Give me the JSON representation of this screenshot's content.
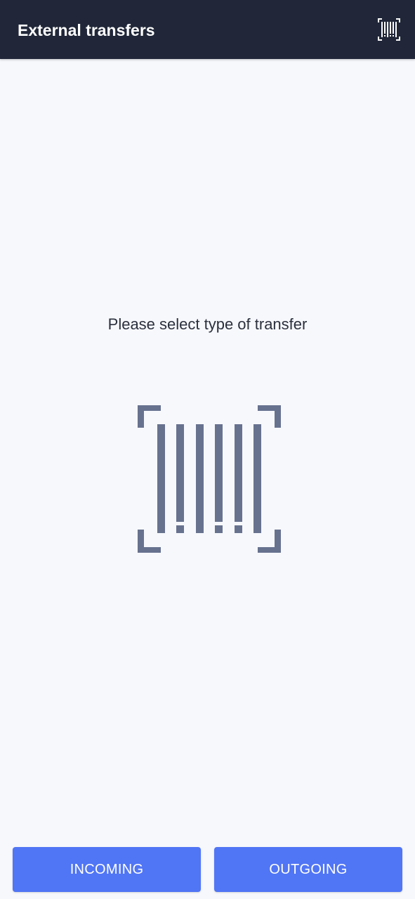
{
  "header": {
    "title": "External transfers",
    "scan_icon": "barcode-scan-icon"
  },
  "main": {
    "prompt": "Please select type of transfer",
    "illustration_icon": "barcode-scan-icon",
    "illustration_color": "#67728f"
  },
  "actions": {
    "incoming_label": "INCOMING",
    "outgoing_label": "OUTGOING",
    "button_color": "#5075f5"
  },
  "colors": {
    "app_bar": "#212739",
    "background": "#f7f8fc"
  }
}
